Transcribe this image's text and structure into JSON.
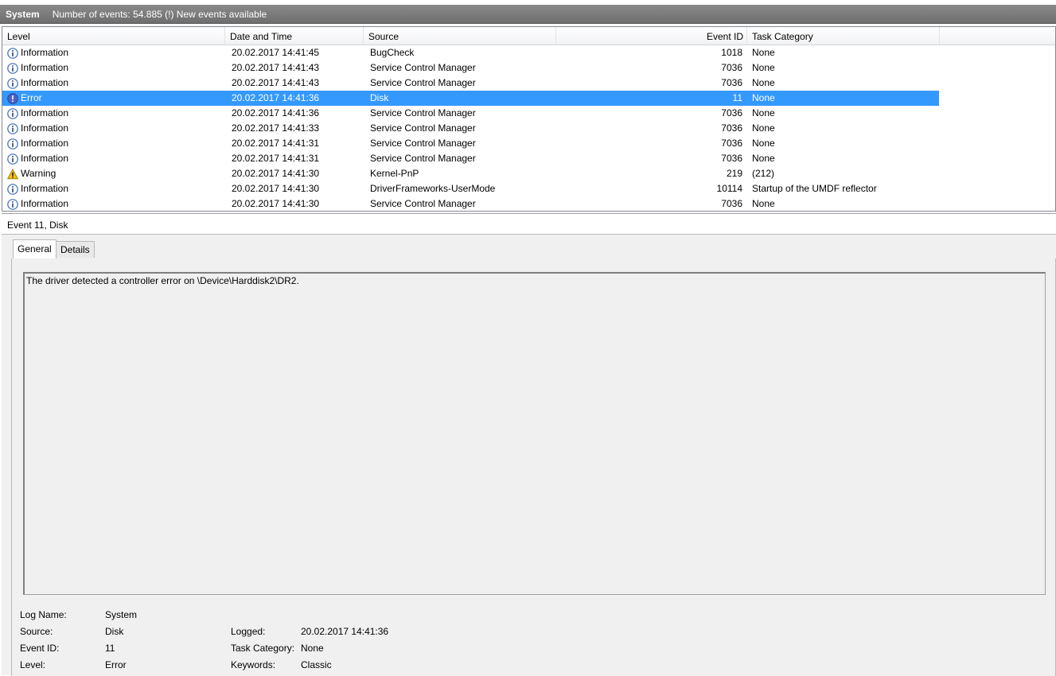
{
  "titlebar": {
    "log_name": "System",
    "status": "Number of events: 54.885 (!) New events available"
  },
  "columns": {
    "level": "Level",
    "date": "Date and Time",
    "source": "Source",
    "event_id": "Event ID",
    "task_category": "Task Category"
  },
  "events": [
    {
      "level": "Information",
      "icon": "info",
      "date": "20.02.2017 14:41:45",
      "source": "BugCheck",
      "event_id": "1018",
      "task_category": "None"
    },
    {
      "level": "Information",
      "icon": "info",
      "date": "20.02.2017 14:41:43",
      "source": "Service Control Manager",
      "event_id": "7036",
      "task_category": "None"
    },
    {
      "level": "Information",
      "icon": "info",
      "date": "20.02.2017 14:41:43",
      "source": "Service Control Manager",
      "event_id": "7036",
      "task_category": "None"
    },
    {
      "level": "Error",
      "icon": "error",
      "date": "20.02.2017 14:41:36",
      "source": "Disk",
      "event_id": "11",
      "task_category": "None",
      "selected": true
    },
    {
      "level": "Information",
      "icon": "info",
      "date": "20.02.2017 14:41:36",
      "source": "Service Control Manager",
      "event_id": "7036",
      "task_category": "None"
    },
    {
      "level": "Information",
      "icon": "info",
      "date": "20.02.2017 14:41:33",
      "source": "Service Control Manager",
      "event_id": "7036",
      "task_category": "None"
    },
    {
      "level": "Information",
      "icon": "info",
      "date": "20.02.2017 14:41:31",
      "source": "Service Control Manager",
      "event_id": "7036",
      "task_category": "None"
    },
    {
      "level": "Information",
      "icon": "info",
      "date": "20.02.2017 14:41:31",
      "source": "Service Control Manager",
      "event_id": "7036",
      "task_category": "None"
    },
    {
      "level": "Warning",
      "icon": "warning",
      "date": "20.02.2017 14:41:30",
      "source": "Kernel-PnP",
      "event_id": "219",
      "task_category": "(212)"
    },
    {
      "level": "Information",
      "icon": "info",
      "date": "20.02.2017 14:41:30",
      "source": "DriverFrameworks-UserMode",
      "event_id": "10114",
      "task_category": "Startup of the UMDF reflector"
    },
    {
      "level": "Information",
      "icon": "info",
      "date": "20.02.2017 14:41:30",
      "source": "Service Control Manager",
      "event_id": "7036",
      "task_category": "None"
    }
  ],
  "detail": {
    "header": "Event 11, Disk",
    "tabs": [
      "General",
      "Details"
    ],
    "description": "The driver detected a controller error on \\Device\\Harddisk2\\DR2.",
    "labels": {
      "log_name": "Log Name:",
      "source": "Source:",
      "event_id": "Event ID:",
      "level": "Level:",
      "logged": "Logged:",
      "task_category": "Task Category:",
      "keywords": "Keywords:"
    },
    "values": {
      "log_name": "System",
      "source": "Disk",
      "event_id": "11",
      "level": "Error",
      "logged": "20.02.2017 14:41:36",
      "task_category": "None",
      "keywords": "Classic"
    }
  },
  "colors": {
    "selection": "#3399ff",
    "titlebar": "#7b7b7b",
    "info_icon": "#3d6bb3",
    "error_icon": "#4a63c9",
    "warning_icon": "#f4c20d"
  }
}
